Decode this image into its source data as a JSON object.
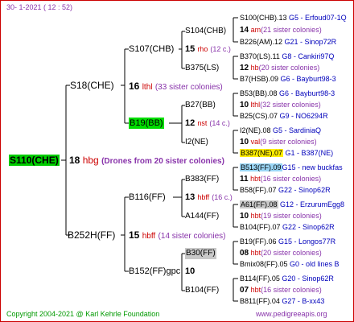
{
  "header": "30-   1-2021  ( 12 :  52)",
  "footer_left": "Copyright 2004-2021 @ Karl Kehrle Foundation",
  "footer_right": "www.pedigreeapis.org",
  "root": {
    "code": "S110(CHE)",
    "num": "18",
    "tag": "hbg",
    "note": "(Drones from 20 sister colonies)"
  },
  "gen1": {
    "sire": {
      "code": "S18(CHE)",
      "num": "16",
      "tag": "lthl",
      "note": "(33 sister colonies)"
    },
    "dam": {
      "code": "B252H(FF)",
      "num": "15",
      "tag": "hbff",
      "note": "(14 sister colonies)"
    }
  },
  "gen2": {
    "a": {
      "code": "S107(CHB)",
      "num": "15",
      "tag": "rho",
      "note": "(12 c.)"
    },
    "b": {
      "code": "B19(BB)",
      "num": "12",
      "tag": "nst",
      "note": "(14 c.)"
    },
    "c": {
      "code": "B116(FF)",
      "num": "13",
      "tag": "hbff",
      "note": "(16 c.)"
    },
    "d": {
      "code": "B152(FF)gpc",
      "num": "10",
      "tag": "",
      "note": ""
    }
  },
  "gen3": {
    "a1": "S104(CHB)",
    "a2": "B375(LS)",
    "b1": "B27(BB)",
    "b2": "I2(NE)",
    "c1": "B383(FF)",
    "c2": "A144(FF)",
    "d1": "B30(FF)",
    "d2": "B104(FF)"
  },
  "gen4": [
    {
      "code": "S100(CHB).13",
      "breeder": "G5 - Erfoud07-1Q"
    },
    {
      "num": "14",
      "tag": "am",
      "note": "(21 sister colonies)"
    },
    {
      "code": "B226(AM).12",
      "breeder": "G21 - Sinop72R"
    },
    {
      "code": "B370(LS).11",
      "breeder": "G8 - Cankiri97Q"
    },
    {
      "num": "12",
      "tag": "hb",
      "note": "(20 sister colonies)"
    },
    {
      "code": "B7(HSB).09",
      "breeder": "G6 - Bayburt98-3"
    },
    {
      "code": "B53(BB).08",
      "breeder": "G6 - Bayburt98-3"
    },
    {
      "num": "10",
      "tag": "lthl",
      "note": "(32 sister colonies)"
    },
    {
      "code": "B25(CS).07",
      "breeder": "G9 - NO6294R"
    },
    {
      "code": "I2(NE).08",
      "breeder": "G5 - SardiniaQ"
    },
    {
      "num": "10",
      "tag": "val",
      "note": "(9 sister colonies)"
    },
    {
      "code": "B387(NE).07",
      "breeder": "G1 - B387(NE)"
    },
    {
      "code": "B513(FF).09",
      "breeder": "G15 - new buckfas"
    },
    {
      "num": "11",
      "tag": "hbt",
      "note": "(16 sister colonies)"
    },
    {
      "code": "B58(FF).07",
      "breeder": "G22 - Sinop62R"
    },
    {
      "code": "A61(FF).08",
      "breeder": "G12 - ErzurumEgg8"
    },
    {
      "num": "10",
      "tag": "hbt",
      "note": "(19 sister colonies)"
    },
    {
      "code": "B104(FF).07",
      "breeder": "G22 - Sinop62R"
    },
    {
      "code": "B19(FF).06",
      "breeder": "G15 - Longos77R"
    },
    {
      "num": "08",
      "tag": "hbt",
      "note": "(20 sister colonies)"
    },
    {
      "code": "Bmix08(FF).05",
      "breeder": "G0 - old lines B"
    },
    {
      "code": "B114(FF).05",
      "breeder": "G20 - Sinop62R"
    },
    {
      "num": "07",
      "tag": "hbt",
      "note": "(16 sister colonies)"
    },
    {
      "code": "B811(FF).04",
      "breeder": "G27 - B-xx43"
    }
  ],
  "colors": {
    "frame": "#cc0000",
    "root_bg": "#00cc00",
    "highlight_green": "#00dd00",
    "highlight_yellow": "#ffee00",
    "highlight_blue": "#9ad6f6",
    "highlight_gray": "#c8c8c8"
  }
}
